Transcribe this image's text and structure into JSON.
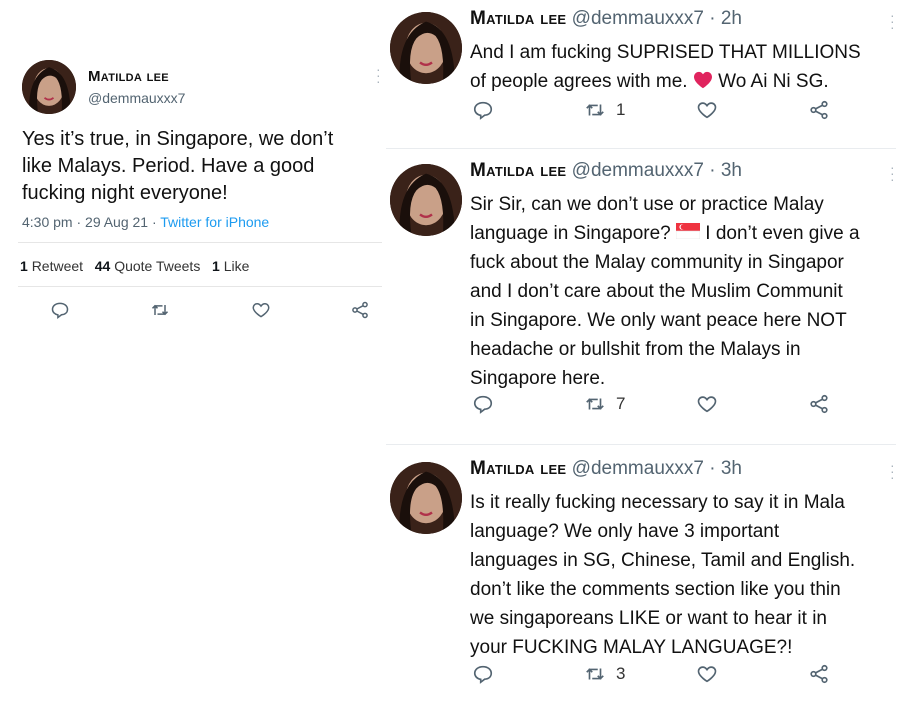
{
  "colors": {
    "handle": "#536471",
    "link": "#1d9bf0",
    "heart": "#e0245e"
  },
  "left_tweet": {
    "name": "Matilda lee",
    "handle": "@demmauxxx7",
    "text": "Yes it’s true, in Singapore, we don’t\nlike Malays. Period. Have a good\nfucking night everyone!",
    "time": "4:30 pm · 29 Aug 21 · ",
    "source": "Twitter for iPhone",
    "retweets_count": "1",
    "retweets_label": "Retweet",
    "quotes_count": "44",
    "quotes_label": "Quote Tweets",
    "likes_count": "1",
    "likes_label": "Like",
    "icons": [
      "reply-icon",
      "retweet-icon",
      "like-icon",
      "share-icon"
    ]
  },
  "right_tweets": [
    {
      "name": "Matilda lee",
      "handle_time": "@demmauxxx7 · 2h",
      "text_a": "And I am fucking SUPRISED THAT MILLIONS\nof people agrees with me. ",
      "heart_icon": "red-heart-emoji",
      "text_b": " Wo Ai Ni SG.",
      "retweets": "1"
    },
    {
      "name": "Matilda lee",
      "handle_time": "@demmauxxx7 · 3h",
      "text_a": "Sir Sir, can we don’t use or practice Malay\nlanguage in Singapore? ",
      "flag_icon": "singapore-flag-emoji",
      "text_b": " I don’t even give a\nfuck about the Malay community in Singapor\nand I don’t care about the Muslim Communit\nin Singapore. We only want peace here NOT\nheadache or bullshit from the Malays in\nSingapore here.",
      "retweets": "7"
    },
    {
      "name": "Matilda lee",
      "handle_time": "@demmauxxx7 · 3h",
      "text": "Is it really fucking necessary to say it in Mala\nlanguage? We only have 3 important\nlanguages in SG, Chinese, Tamil and English.\ndon’t like the comments section like you thin\nwe singaporeans LIKE or want to hear it in\nyour FUCKING MALAY LANGUAGE?!",
      "retweets": "3"
    }
  ]
}
